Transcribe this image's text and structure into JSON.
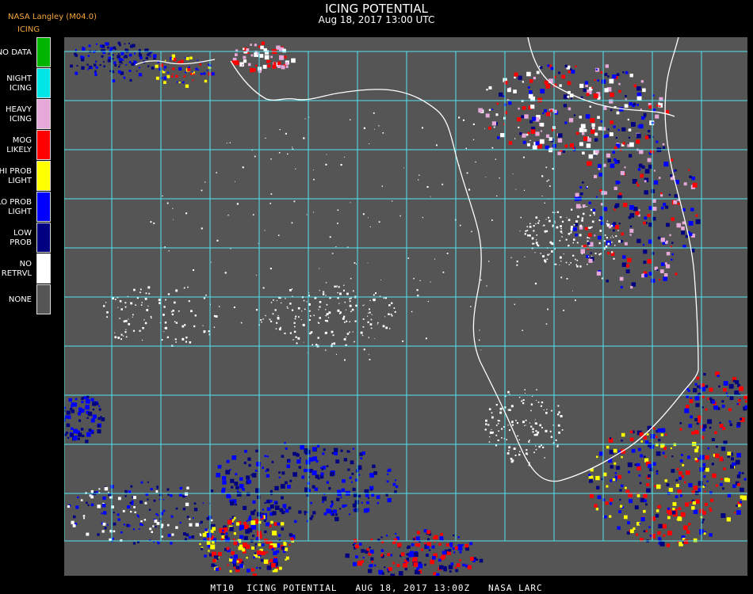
{
  "header": {
    "title": "ICING POTENTIAL",
    "subtitle": "Aug 18, 2017 13:00 UTC",
    "brand": "NASA Langley (M04.0)",
    "legend_title": "ICING"
  },
  "legend": [
    {
      "line1": "NO DATA",
      "line2": "",
      "color": "#00b400"
    },
    {
      "line1": "NIGHT",
      "line2": "ICING",
      "color": "#00e6e6"
    },
    {
      "line1": "HEAVY",
      "line2": "ICING",
      "color": "#e6a8d8"
    },
    {
      "line1": "MOG",
      "line2": "LIKELY",
      "color": "#ff0000"
    },
    {
      "line1": "HI PROB",
      "line2": "LIGHT",
      "color": "#ffff00"
    },
    {
      "line1": "LO PROB",
      "line2": "LIGHT",
      "color": "#0000ff"
    },
    {
      "line1": "LOW",
      "line2": "PROB",
      "color": "#000080"
    },
    {
      "line1": "NO",
      "line2": "RETRVL",
      "color": "#ffffff"
    },
    {
      "line1": "NONE",
      "line2": "",
      "color": "#555555"
    }
  ],
  "footer": "MT10  ICING POTENTIAL   AUG 18, 2017 13:00Z   NASA LARC",
  "colors": {
    "background": "#555555",
    "grid": "#4ee6f0",
    "coast": "#ffffff"
  }
}
